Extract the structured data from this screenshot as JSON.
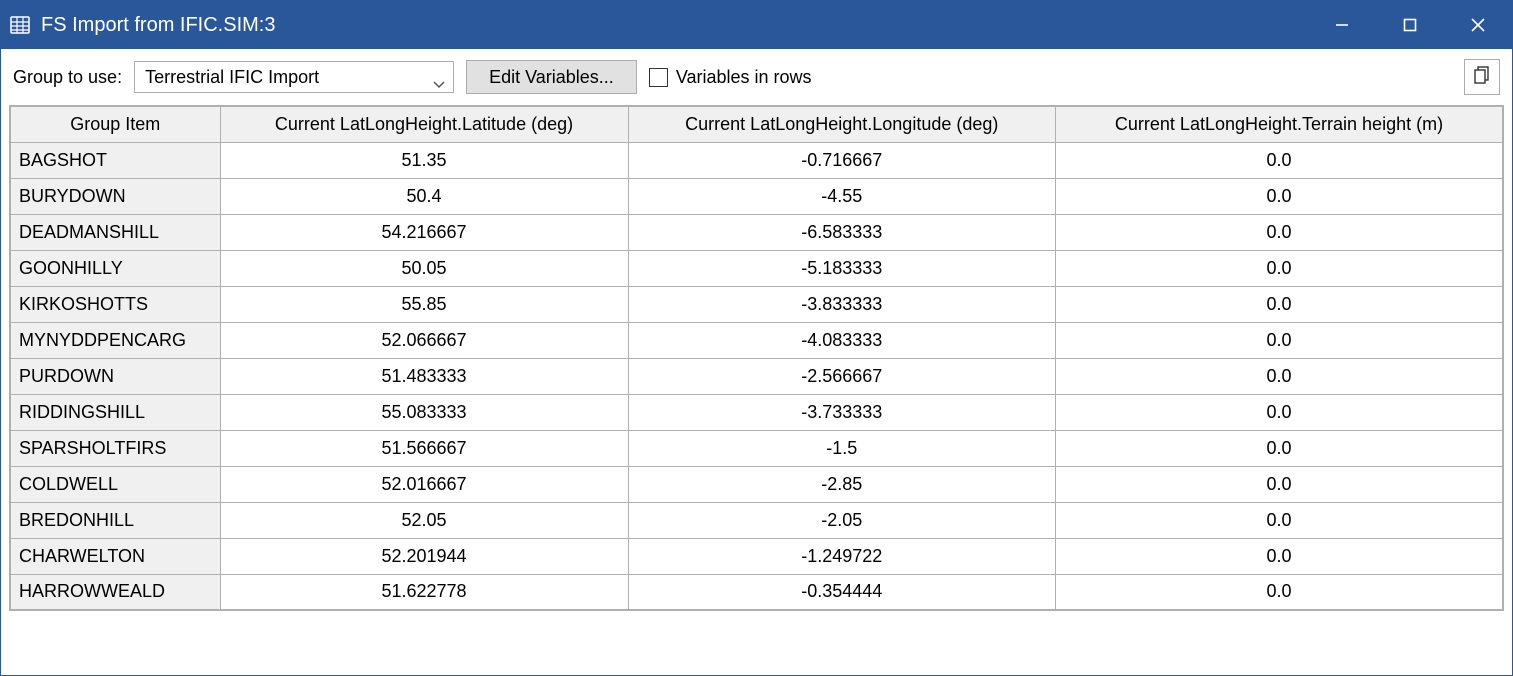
{
  "window": {
    "title": "FS Import from IFIC.SIM:3"
  },
  "toolbar": {
    "group_label": "Group to use:",
    "group_selected": "Terrestrial IFIC Import",
    "edit_variables_label": "Edit Variables...",
    "vars_in_rows_label": "Variables in rows"
  },
  "table": {
    "headers": {
      "group_item": "Group Item",
      "lat": "Current LatLongHeight.Latitude (deg)",
      "lon": "Current LatLongHeight.Longitude (deg)",
      "height": "Current LatLongHeight.Terrain height (m)"
    },
    "rows": [
      {
        "name": "BAGSHOT",
        "lat": "51.35",
        "lon": "-0.716667",
        "height": "0.0"
      },
      {
        "name": "BURYDOWN",
        "lat": "50.4",
        "lon": "-4.55",
        "height": "0.0"
      },
      {
        "name": "DEADMANSHILL",
        "lat": "54.216667",
        "lon": "-6.583333",
        "height": "0.0"
      },
      {
        "name": "GOONHILLY",
        "lat": "50.05",
        "lon": "-5.183333",
        "height": "0.0"
      },
      {
        "name": "KIRKOSHOTTS",
        "lat": "55.85",
        "lon": "-3.833333",
        "height": "0.0"
      },
      {
        "name": "MYNYDDPENCARG",
        "lat": "52.066667",
        "lon": "-4.083333",
        "height": "0.0"
      },
      {
        "name": "PURDOWN",
        "lat": "51.483333",
        "lon": "-2.566667",
        "height": "0.0"
      },
      {
        "name": "RIDDINGSHILL",
        "lat": "55.083333",
        "lon": "-3.733333",
        "height": "0.0"
      },
      {
        "name": "SPARSHOLTFIRS",
        "lat": "51.566667",
        "lon": "-1.5",
        "height": "0.0"
      },
      {
        "name": "COLDWELL",
        "lat": "52.016667",
        "lon": "-2.85",
        "height": "0.0"
      },
      {
        "name": "BREDONHILL",
        "lat": "52.05",
        "lon": "-2.05",
        "height": "0.0"
      },
      {
        "name": "CHARWELTON",
        "lat": "52.201944",
        "lon": "-1.249722",
        "height": "0.0"
      },
      {
        "name": "HARROWWEALD",
        "lat": "51.622778",
        "lon": "-0.354444",
        "height": "0.0"
      }
    ]
  }
}
